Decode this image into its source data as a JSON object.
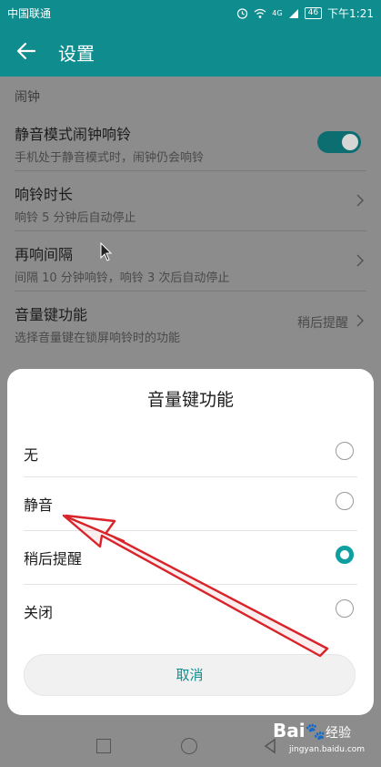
{
  "status_bar": {
    "carrier": "中国联通",
    "signal_label": "4G",
    "battery": "46",
    "time": "下午1:21"
  },
  "app_bar": {
    "title": "设置",
    "back_icon": "arrow-left-icon"
  },
  "section": {
    "label": "闹钟"
  },
  "settings": [
    {
      "title": "静音模式闹钟响铃",
      "subtitle": "手机处于静音模式时，闹钟仍会响铃",
      "toggle_on": true
    },
    {
      "title": "响铃时长",
      "subtitle": "响铃 5 分钟后自动停止"
    },
    {
      "title": "再响间隔",
      "subtitle": "间隔 10 分钟响铃，响铃 3 次后自动停止"
    },
    {
      "title": "音量键功能",
      "subtitle": "选择音量键在锁屏响铃时的功能",
      "value": "稍后提醒"
    }
  ],
  "dialog": {
    "title": "音量键功能",
    "options": [
      {
        "label": "无",
        "selected": false
      },
      {
        "label": "静音",
        "selected": false
      },
      {
        "label": "稍后提醒",
        "selected": true
      },
      {
        "label": "关闭",
        "selected": false
      }
    ],
    "cancel_label": "取消"
  },
  "watermark": {
    "main": "Bai",
    "main_cn": "经验",
    "sub": "jingyan.baidu.com"
  },
  "colors": {
    "accent": "#0f8c8e",
    "radio_selected": "#0f9fa1",
    "annotation_arrow": "#d9232a"
  }
}
